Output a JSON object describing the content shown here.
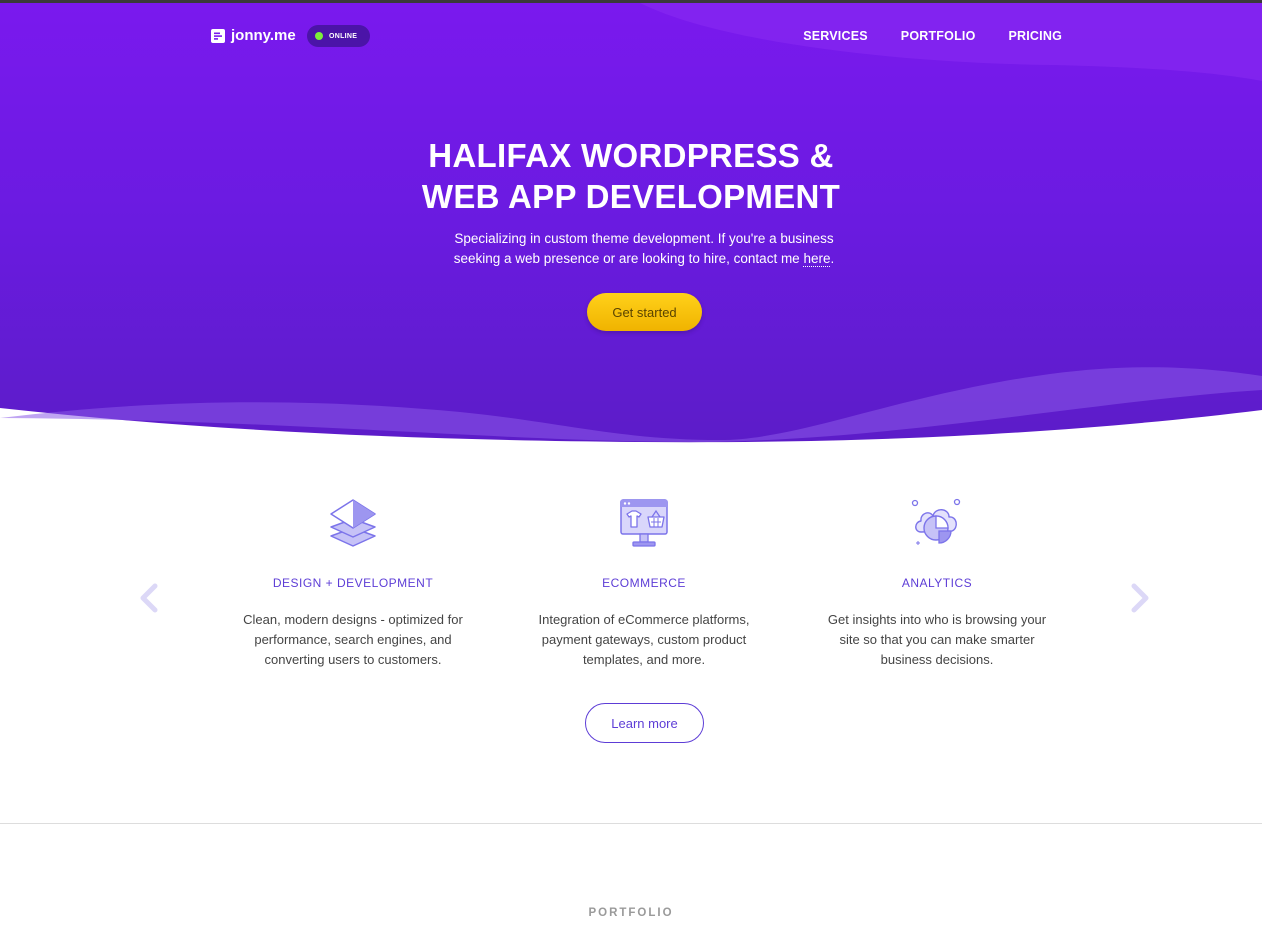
{
  "brand": {
    "name": "jonny.me",
    "status": "ONLINE",
    "status_color": "#7cf03a"
  },
  "nav": {
    "items": [
      {
        "label": "SERVICES"
      },
      {
        "label": "PORTFOLIO"
      },
      {
        "label": "PRICING"
      }
    ]
  },
  "hero": {
    "title_line1": "HALIFAX WORDPRESS &",
    "title_line2": "WEB APP DEVELOPMENT",
    "subtitle_prefix": "Specializing in custom theme development. If you're a business seeking a web presence or are looking to hire, contact me ",
    "subtitle_link": "here",
    "subtitle_suffix": ".",
    "cta_label": "Get started",
    "gradient_top": "#7a19ee",
    "gradient_bottom": "#5c1cc8",
    "cta_color": "#f5c000"
  },
  "services": {
    "items": [
      {
        "title": "DESIGN + DEVELOPMENT",
        "icon": "layers-icon",
        "description": "Clean, modern designs - optimized for performance, search engines, and converting users to customers."
      },
      {
        "title": "ECOMMERCE",
        "icon": "monitor-shop-icon",
        "description": "Integration of eCommerce platforms, payment gateways, custom product templates, and more."
      },
      {
        "title": "ANALYTICS",
        "icon": "cloud-chart-icon",
        "description": "Get insights into who is browsing your site so that you can make smarter business decisions."
      }
    ],
    "prev_icon": "chevron-left-icon",
    "next_icon": "chevron-right-icon",
    "learn_more_label": "Learn more",
    "accent": "#5d3dd6"
  },
  "portfolio": {
    "label": "PORTFOLIO"
  }
}
